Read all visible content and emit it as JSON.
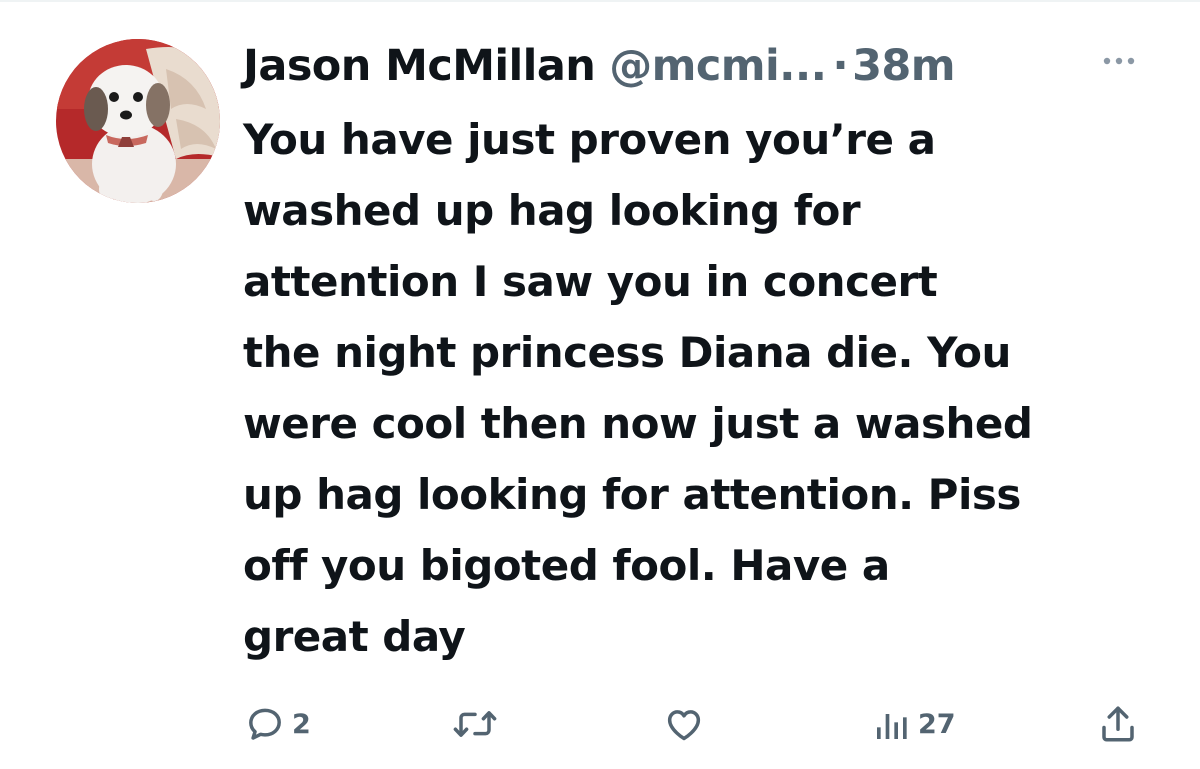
{
  "tweet": {
    "display_name": "Jason McMillan",
    "handle": "@mcmi...",
    "separator": "·",
    "time": "38m",
    "text": "You have just proven you’re a\nwashed up hag looking for\nattention   I saw you in concert\nthe night princess Diana die. You\nwere cool then now just a washed\nup hag looking for attention. Piss\noff you bigoted fool.  Have a\ngreat day"
  },
  "actions": {
    "reply_count": "2",
    "retweet_count": "",
    "like_count": "",
    "views_count": "27"
  },
  "icons": {
    "avatar": "dog-avatar",
    "more": "more-horizontal-icon",
    "reply": "reply-icon",
    "retweet": "retweet-icon",
    "like": "like-icon",
    "views": "views-icon",
    "share": "share-icon"
  },
  "colors": {
    "text_primary": "#0f1419",
    "text_secondary": "#536471",
    "divider": "#eff3f4"
  }
}
